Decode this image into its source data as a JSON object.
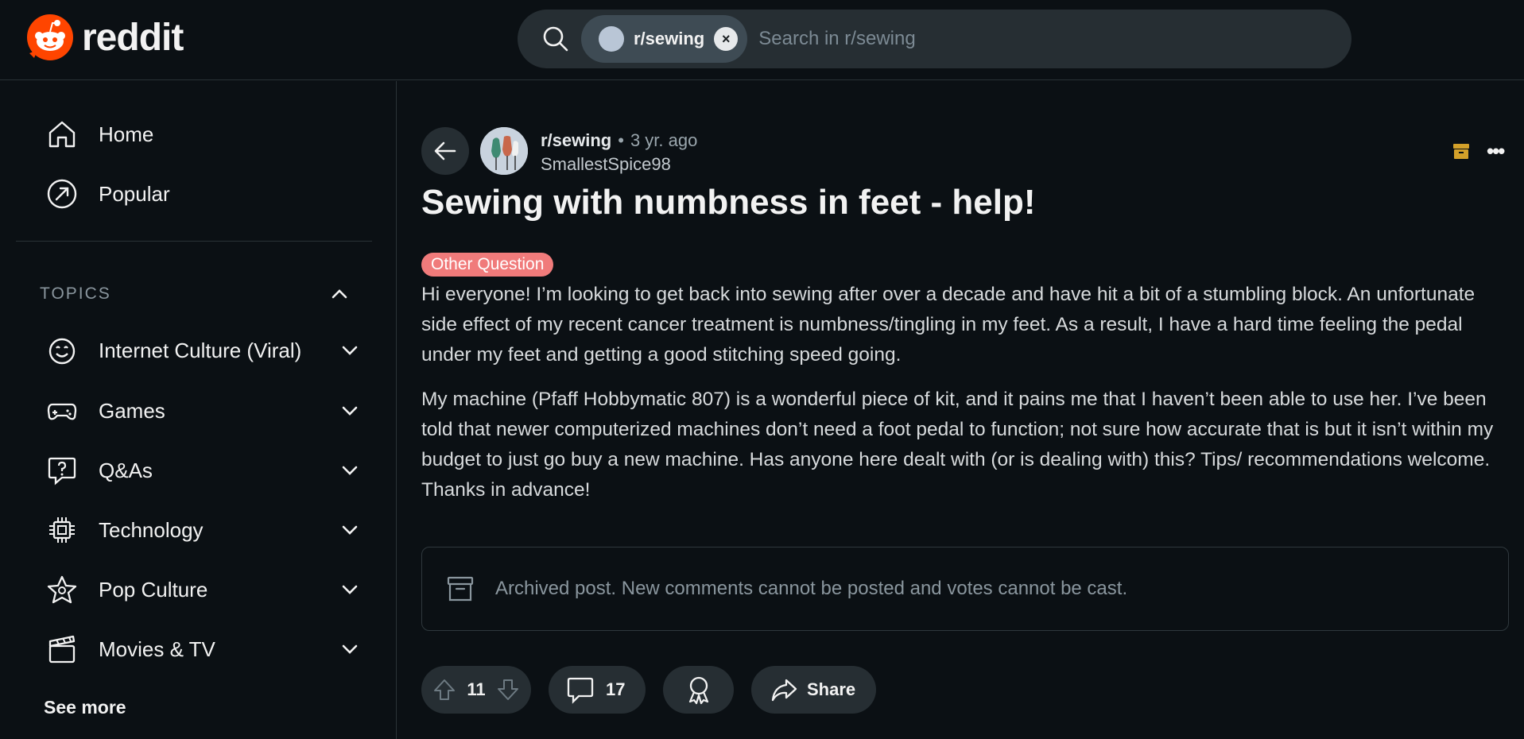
{
  "header": {
    "logo_text": "reddit",
    "search": {
      "chip_label": "r/sewing",
      "chip_remove": "×",
      "placeholder": "Search in r/sewing"
    }
  },
  "sidebar": {
    "nav": [
      {
        "label": "Home",
        "icon": "home-icon"
      },
      {
        "label": "Popular",
        "icon": "popular-icon"
      }
    ],
    "topics_header": "TOPICS",
    "topics": [
      {
        "label": "Internet Culture (Viral)",
        "icon": "smile-icon"
      },
      {
        "label": "Games",
        "icon": "gamepad-icon"
      },
      {
        "label": "Q&As",
        "icon": "question-bubble-icon"
      },
      {
        "label": "Technology",
        "icon": "chip-icon"
      },
      {
        "label": "Pop Culture",
        "icon": "star-badge-icon"
      },
      {
        "label": "Movies & TV",
        "icon": "clapperboard-icon"
      }
    ],
    "see_more": "See more"
  },
  "post": {
    "subreddit": "r/sewing",
    "separator": "•",
    "time": "3 yr. ago",
    "author": "SmallestSpice98",
    "title": "Sewing with numbness in feet - help!",
    "flair": "Other Question",
    "flair_color": "#f07b7b",
    "body": [
      "Hi everyone! I’m looking to get back into sewing after over a decade and have hit a bit of a stumbling block. An unfortunate side effect of my recent cancer treatment is numbness/tingling in my feet. As a result, I have a hard time feeling the pedal under my feet and getting a good stitching speed going.",
      "My machine (Pfaff Hobbymatic 807) is a wonderful piece of kit, and it pains me that I haven’t been able to use her. I’ve been told that newer computerized machines don’t need a foot pedal to function; not sure how accurate that is but it isn’t within my budget to just go buy a new machine. Has anyone here dealt with (or is dealing with) this? Tips/ recommendations welcome. Thanks in advance!"
    ],
    "archived_notice": "Archived post. New comments cannot be posted and votes cannot be cast.",
    "votes": "11",
    "comments": "17",
    "share_label": "Share",
    "archive_icon_color": "#d4a12a"
  }
}
